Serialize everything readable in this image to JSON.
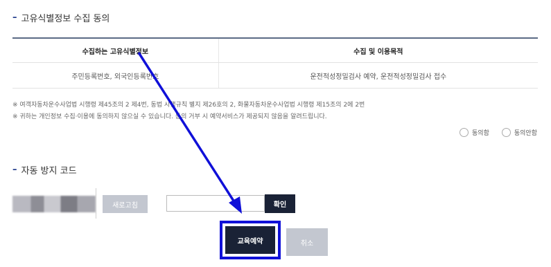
{
  "consent_section": {
    "title": "고유식별정보 수집 동의",
    "table": {
      "headers": [
        "수집하는 고유식별정보",
        "수집 및 이용목적"
      ],
      "rows": [
        [
          "주민등록번호, 외국인등록번호",
          "운전적성정밀검사 예약, 운전적성정밀검사 접수"
        ]
      ]
    },
    "notes": [
      "※ 여객자동차운수사업법 시행령 제45조의 2 제4번, 동법 시행규칙 별지 제26호의 2, 화물자동차운수사업법 시행령 제15조의 2에 2번",
      "※ 귀하는 개인정보 수집·이용에 동의하지 않으실 수 있습니다. 동의 거부 시 예약서비스가 제공되지 않음을 알려드립니다."
    ],
    "radio_options": [
      "동의함",
      "동의안함"
    ]
  },
  "captcha_section": {
    "title": "자동 방지 코드",
    "refresh_label": "새로고침",
    "input_value": "",
    "confirm_label": "확인"
  },
  "actions": {
    "reserve_label": "교육예약",
    "cancel_label": "취소"
  },
  "colors": {
    "primary": "#1a2236",
    "disabled": "#c3c7d0",
    "annotation": "#1010d8"
  }
}
